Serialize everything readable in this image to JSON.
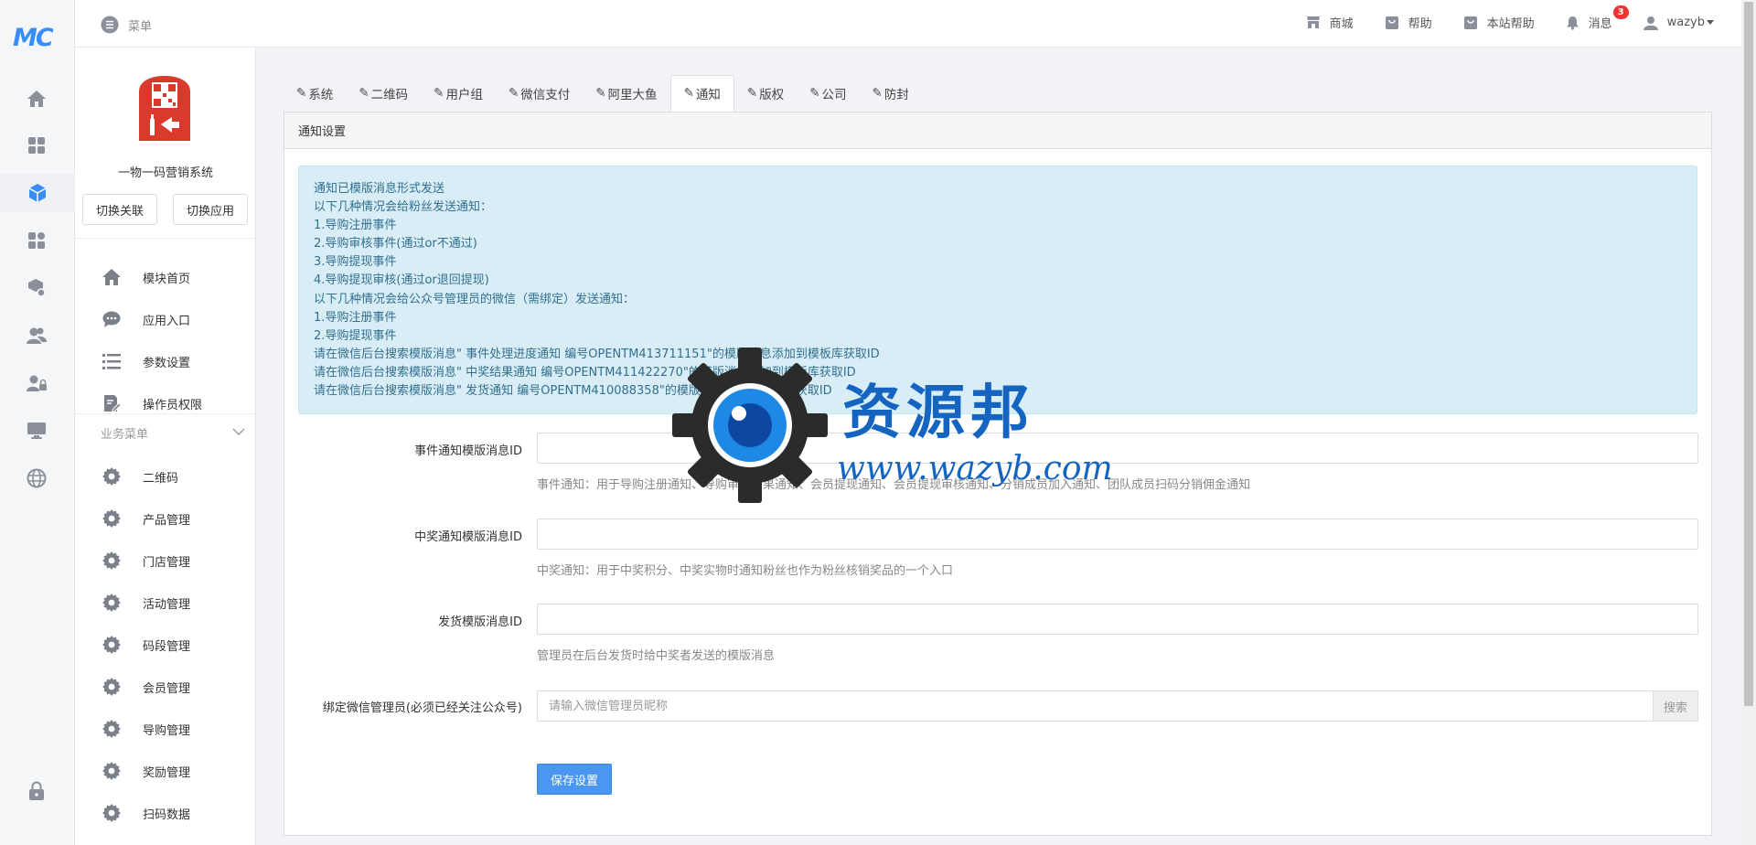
{
  "brand": {
    "logo_text": "MC"
  },
  "topbar": {
    "menu_label": "菜单",
    "links": [
      {
        "label": "商城",
        "icon": "store-icon"
      },
      {
        "label": "帮助",
        "icon": "help-bag-icon"
      },
      {
        "label": "本站帮助",
        "icon": "site-help-icon"
      },
      {
        "label": "消息",
        "icon": "bell-icon",
        "badge": "3"
      }
    ],
    "user": "wazyb"
  },
  "sidebar": {
    "app_name": "一物一码营销系统",
    "switch_association": "切换关联",
    "switch_app": "切换应用",
    "main_items": [
      {
        "label": "模块首页",
        "icon": "home-icon"
      },
      {
        "label": "应用入口",
        "icon": "chat-icon"
      },
      {
        "label": "参数设置",
        "icon": "list-icon"
      },
      {
        "label": "操作员权限",
        "icon": "edit-doc-icon"
      }
    ],
    "business_title": "业务菜单",
    "business_items": [
      {
        "label": "二维码"
      },
      {
        "label": "产品管理"
      },
      {
        "label": "门店管理"
      },
      {
        "label": "活动管理"
      },
      {
        "label": "码段管理"
      },
      {
        "label": "会员管理"
      },
      {
        "label": "导购管理"
      },
      {
        "label": "奖励管理"
      },
      {
        "label": "扫码数据"
      }
    ]
  },
  "tabs": [
    {
      "label": "系统"
    },
    {
      "label": "二维码"
    },
    {
      "label": "用户组"
    },
    {
      "label": "微信支付"
    },
    {
      "label": "阿里大鱼"
    },
    {
      "label": "通知",
      "active": true
    },
    {
      "label": "版权"
    },
    {
      "label": "公司"
    },
    {
      "label": "防封"
    }
  ],
  "panel": {
    "title": "通知设置",
    "notice_lines": [
      "通知已模版消息形式发送",
      "以下几种情况会给粉丝发送通知：",
      "1.导购注册事件",
      "2.导购审核事件(通过or不通过)",
      "3.导购提现事件",
      "4.导购提现审核(通过or退回提现)",
      "以下几种情况会给公众号管理员的微信（需绑定）发送通知：",
      "1.导购注册事件",
      "2.导购提现事件",
      "请在微信后台搜索模版消息\" 事件处理进度通知 编号OPENTM413711151\"的模版消息添加到模板库获取ID",
      "请在微信后台搜索模版消息\" 中奖结果通知 编号OPENTM411422270\"的模版消息添加到模板库获取ID",
      "请在微信后台搜索模版消息\" 发货通知 编号OPENTM410088358\"的模版消息添加到模板库获取ID"
    ],
    "fields": {
      "event_label": "事件通知模版消息ID",
      "event_value": "",
      "event_help": "事件通知：用于导购注册通知、导购审核结果通知、会员提现通知、会员提现审核通知、分销成员加入通知、团队成员扫码分销佣金通知",
      "prize_label": "中奖通知模版消息ID",
      "prize_value": "",
      "prize_help": "中奖通知：用于中奖积分、中奖实物时通知粉丝也作为粉丝核销奖品的一个入口",
      "ship_label": "发货模版消息ID",
      "ship_value": "",
      "ship_help": "管理员在后台发货时给中奖者发送的模版消息",
      "bind_label": "绑定微信管理员(必须已经关注公众号)",
      "bind_placeholder": "请输入微信管理员昵称",
      "search_label": "搜索"
    },
    "save_label": "保存设置"
  },
  "watermark": {
    "title": "资源邦",
    "url": "www.wazyb.com"
  },
  "colors": {
    "accent": "#4a96f0",
    "notice_bg": "#d9edf7",
    "notice_text": "#31708f",
    "badge": "#e33333",
    "logo_red": "#d93a2b"
  }
}
